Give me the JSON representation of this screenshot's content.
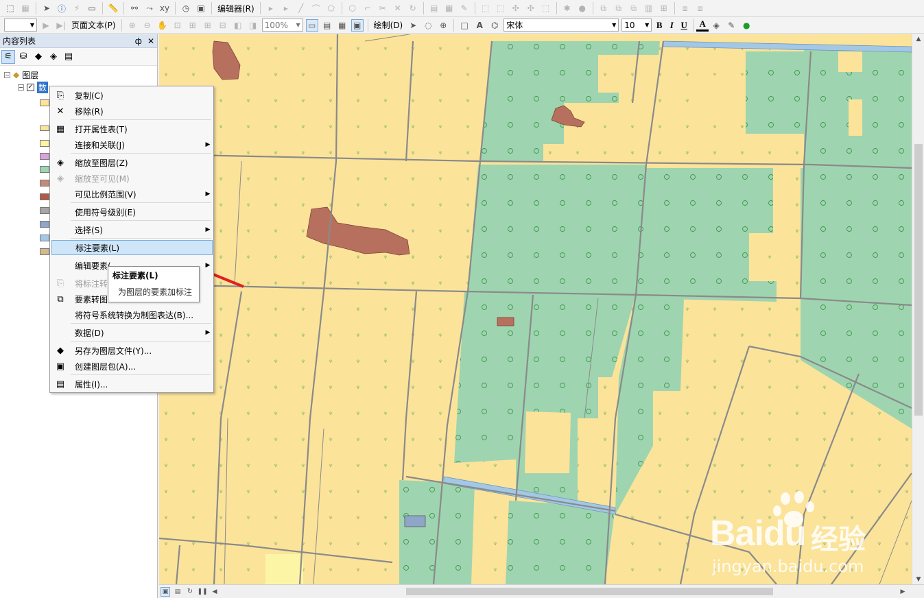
{
  "toolbar": {
    "editor_label": "编辑器(R)",
    "layout_label": "页面文本(P)",
    "zoom_value": "100%",
    "draw_label": "绘制(D)",
    "font_name": "宋体",
    "font_size": "10",
    "bold": "B",
    "italic": "I",
    "underline": "U",
    "font_color_glyph": "A"
  },
  "toc": {
    "title": "内容列表",
    "pin": "ф",
    "close": "✕",
    "root_layer": "图层",
    "selected_layer": "数"
  },
  "legend_colors": [
    "#fbe39a",
    "#ffffff",
    "#fbe39a",
    "#fdf5a6",
    "#d9a3d9",
    "#9fd4b0",
    "#c28a7a",
    "#b0584a",
    "#a6a6a6",
    "#8ea6c8",
    "#a2c8e6",
    "#d6b98a"
  ],
  "context_menu": {
    "items": [
      {
        "label": "复制(C)",
        "icon": "copy-icon",
        "glyph": "⎘"
      },
      {
        "label": "移除(R)",
        "icon": "remove-icon",
        "glyph": "✕"
      },
      {
        "label": "打开属性表(T)",
        "icon": "table-icon",
        "glyph": "▦"
      },
      {
        "label": "连接和关联(J)",
        "icon": "",
        "glyph": "",
        "submenu": true
      },
      {
        "label": "缩放至图层(Z)",
        "icon": "zoom-layer-icon",
        "glyph": "◈"
      },
      {
        "label": "缩放至可见(M)",
        "icon": "zoom-visible-icon",
        "glyph": "◈",
        "disabled": true
      },
      {
        "label": "可见比例范围(V)",
        "icon": "",
        "glyph": "",
        "submenu": true
      },
      {
        "label": "使用符号级别(E)",
        "icon": "",
        "glyph": ""
      },
      {
        "label": "选择(S)",
        "icon": "",
        "glyph": "",
        "submenu": true
      },
      {
        "label": "标注要素(L)",
        "icon": "",
        "glyph": "",
        "highlighted": true
      },
      {
        "label": "编辑要素(",
        "icon": "",
        "glyph": "",
        "submenu": true
      },
      {
        "label": "将标注转",
        "icon": "convert-labels-icon",
        "glyph": "⎘",
        "disabled": true
      },
      {
        "label": "要素转图",
        "icon": "feature-graphic-icon",
        "glyph": "⧉"
      },
      {
        "label": "将符号系统转换为制图表达(B)...",
        "icon": "",
        "glyph": ""
      },
      {
        "label": "数据(D)",
        "icon": "",
        "glyph": "",
        "submenu": true
      },
      {
        "label": "另存为图层文件(Y)...",
        "icon": "layer-file-icon",
        "glyph": "◆"
      },
      {
        "label": "创建图层包(A)...",
        "icon": "layer-package-icon",
        "glyph": "▣"
      },
      {
        "label": "属性(I)...",
        "icon": "properties-icon",
        "glyph": "▤"
      }
    ]
  },
  "tooltip": {
    "title": "标注要素(L)",
    "description": "为图层的要素加标注"
  },
  "watermark": {
    "logo": "Baidu",
    "cn": "经验",
    "url": "jingyan.baidu.com"
  },
  "colors": {
    "farmland": "#fbe39a",
    "forest": "#9fd4b0",
    "building": "#b8705e",
    "water": "#a2c8e6",
    "highlight": "#cfe5f8",
    "arrow": "#e02020"
  }
}
